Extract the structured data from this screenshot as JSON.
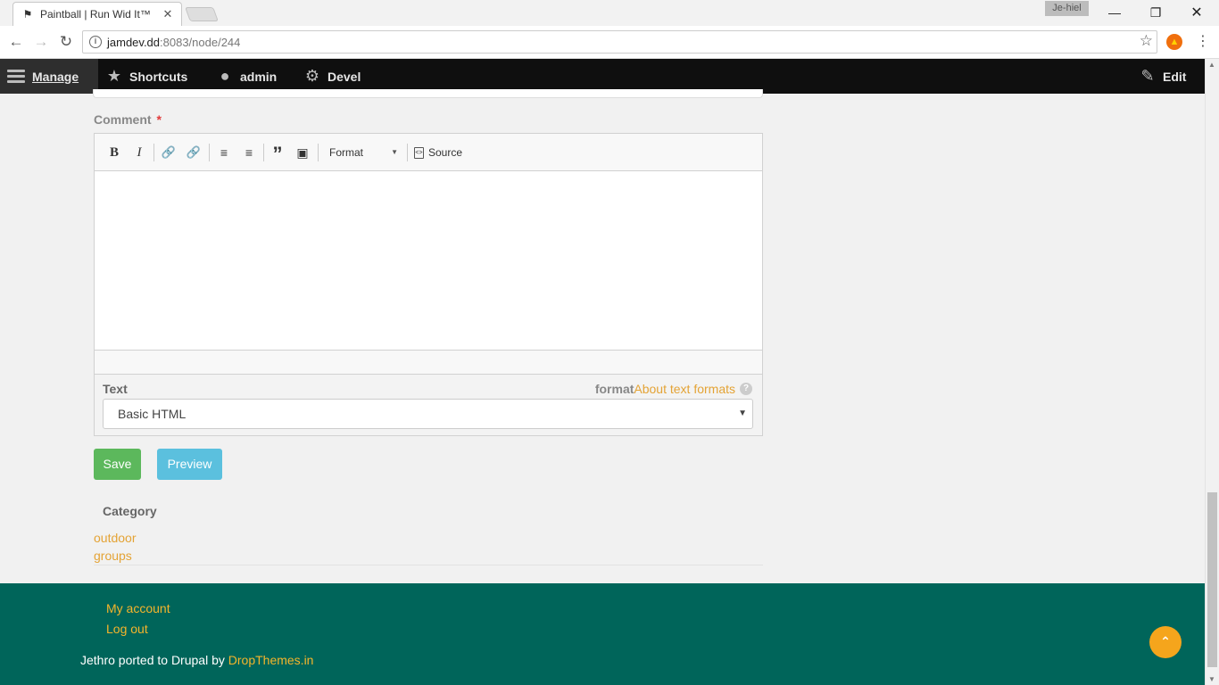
{
  "browser": {
    "tab_title": "Paintball | Run Wid It™",
    "tab_favicon": "runner-icon",
    "profile_name": "Je-hiel",
    "url_host": "jamdev.dd",
    "url_path": ":8083/node/244"
  },
  "toolbar": {
    "manage": "Manage",
    "shortcuts": "Shortcuts",
    "admin": "admin",
    "devel": "Devel",
    "edit": "Edit"
  },
  "comment": {
    "label": "Comment",
    "required_mark": "*",
    "editor": {
      "bold": "B",
      "italic": "I",
      "format_label": "Format",
      "source_label": "Source"
    },
    "text_format": {
      "label": "Text",
      "help_word": "format",
      "help_link": "About text formats",
      "selected": "Basic HTML"
    }
  },
  "actions": {
    "save": "Save",
    "preview": "Preview"
  },
  "category": {
    "label": "Category",
    "items": [
      "outdoor",
      "groups"
    ]
  },
  "footer": {
    "links": [
      "My account",
      "Log out"
    ],
    "credit_text": "Jethro ported to Drupal by ",
    "credit_link": "DropThemes.in"
  },
  "colors": {
    "accent_link": "#e4a335",
    "save_button": "#5cb85c",
    "preview_button": "#5bc0de",
    "footer_bg": "#00655a",
    "back_to_top": "#f5a51c"
  }
}
